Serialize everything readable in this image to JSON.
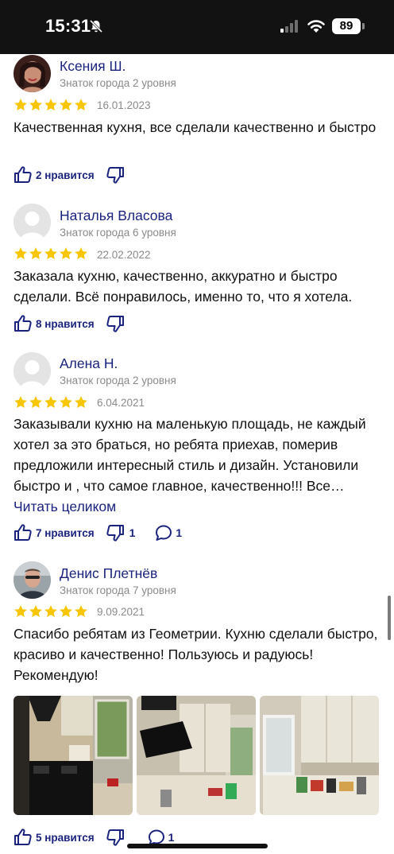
{
  "status_bar": {
    "time": "15:31",
    "battery": "89"
  },
  "reviews": [
    {
      "author": "Ксения Ш.",
      "level": "Знаток города 2 уровня",
      "rating": 5,
      "date": "16.01.2023",
      "text": "Качественная кухня, все сделали качественно и быстро",
      "likes_label": "2 нравится"
    },
    {
      "author": "Наталья Власова",
      "level": "Знаток города 6 уровня",
      "rating": 5,
      "date": "22.02.2022",
      "text": "Заказала кухню, качественно, аккуратно и быстро сделали. Всё понравилось, именно то, что я хотела.",
      "likes_label": "8 нравится"
    },
    {
      "author": "Алена Н.",
      "level": "Знаток города 2 уровня",
      "rating": 5,
      "date": "6.04.2021",
      "text": "Заказывали кухню на маленькую площадь, не каждый хотел за это браться, но ребята приехав, померив предложили интересный стиль и дизайн. Установили быстро и , что самое главное, качественно!!! Все…",
      "read_more": "Читать целиком",
      "likes_label": "7 нравится",
      "dislikes": "1",
      "comments": "1"
    },
    {
      "author": "Денис Плетнёв",
      "level": "Знаток города 7 уровня",
      "rating": 5,
      "date": "9.09.2021",
      "text": "Спасибо ребятам из Геометрии. Кухню сделали быстро, красиво и качественно! Пользуюсь и радуюсь! Рекомендую!",
      "likes_label": "5 нравится",
      "comments": "1"
    }
  ],
  "icons": {
    "star": "star-icon",
    "like": "thumbs-up-icon",
    "dislike": "thumbs-down-icon",
    "comment": "comment-icon"
  },
  "colors": {
    "accent": "#1a237e",
    "star": "#f7c600",
    "muted": "#8a8a8a"
  }
}
